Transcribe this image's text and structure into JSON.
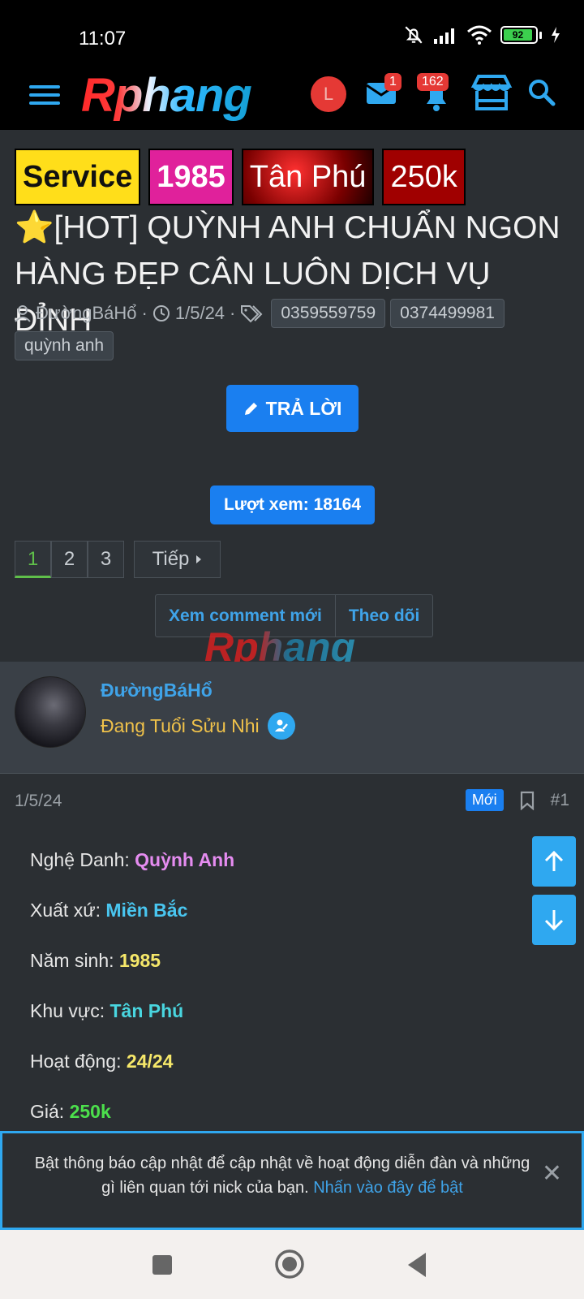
{
  "status_bar": {
    "time": "11:07",
    "battery": "92"
  },
  "topnav": {
    "logo": "Rphang",
    "avatar_letter": "L",
    "messages_badge": "1",
    "alerts_badge": "162"
  },
  "thread": {
    "labels": [
      "Service",
      "1985",
      "Tân Phú",
      "250k"
    ],
    "title": "⭐[HOT] QUỲNH ANH CHUẨN NGON HÀNG ĐẸP CÂN LUÔN DỊCH VỤ ĐỈNH",
    "author": "ĐườngBáHổ",
    "date": "1/5/24",
    "tags": [
      "0359559759",
      "0374499981",
      "quỳnh anh"
    ],
    "reply_label": "TRẢ LỜI",
    "views": "Lượt xem: 18164",
    "pages": [
      "1",
      "2",
      "3"
    ],
    "next_label": "Tiếp",
    "new_comments_label": "Xem comment mới",
    "follow_label": "Theo dõi",
    "watermark": "Rphang"
  },
  "post": {
    "user_name": "ĐườngBáHổ",
    "user_title": "Đang Tuổi Sửu Nhi",
    "date": "1/5/24",
    "new_badge": "Mới",
    "number": "#1",
    "fields": [
      {
        "label": "Nghệ Danh:",
        "value": "Quỳnh Anh",
        "color": "#e58cf0"
      },
      {
        "label": "Xuất xứ:",
        "value": "Miền Bắc",
        "color": "#49c6f0"
      },
      {
        "label": "Năm sinh:",
        "value": "1985",
        "color": "#f6e86a"
      },
      {
        "label": "Khu vực:",
        "value": "Tân Phú",
        "color": "#49d6e0"
      },
      {
        "label": "Hoạt động:",
        "value": "24/24",
        "color": "#f6e86a"
      },
      {
        "label": "Giá:",
        "value": "250k",
        "color": "#4ce04c"
      }
    ]
  },
  "notification": {
    "text": "Bật thông báo cập nhật để cập nhật về hoạt động diễn đàn và những gì liên quan tới nick của bạn.",
    "link": "Nhấn vào đây để bật",
    "close": "✕"
  }
}
